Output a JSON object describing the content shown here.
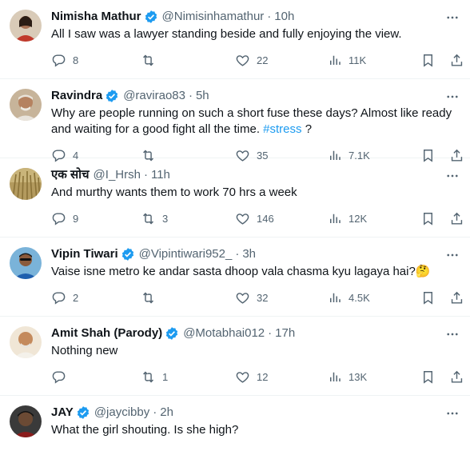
{
  "colors": {
    "accent": "#1d9bf0",
    "text": "#0f1419",
    "muted": "#536471",
    "divider": "#eff3f4"
  },
  "tweets": [
    {
      "name": "Nimisha Mathur",
      "verified": true,
      "handle": "@Nimisinhamathur",
      "time": "10h",
      "text": "All I saw was a lawyer standing beside and fully enjoying the view.",
      "replies": "8",
      "retweets": "",
      "likes": "22",
      "views": "11K"
    },
    {
      "name": "Ravindra",
      "verified": true,
      "handle": "@ravirao83",
      "time": "5h",
      "text": "Why are people running on such a short fuse these days? Almost like ready and waiting for a good fight all the time.",
      "hashtag": "#stress",
      "text_suffix": " ?",
      "replies": "4",
      "retweets": "",
      "likes": "35",
      "views": "7.1K"
    },
    {
      "name": "एक सोच",
      "verified": false,
      "handle": "@I_Hrsh",
      "time": "11h",
      "text": "And murthy wants them to work 70 hrs a week",
      "replies": "9",
      "retweets": "3",
      "likes": "146",
      "views": "12K"
    },
    {
      "name": "Vipin Tiwari",
      "verified": true,
      "handle": "@Vipintiwari952_",
      "time": "3h",
      "text": "Vaise isne metro ke andar sasta dhoop vala chasma kyu lagaya hai?🤔",
      "replies": "2",
      "retweets": "",
      "likes": "32",
      "views": "4.5K"
    },
    {
      "name": "Amit Shah (Parody)",
      "verified": true,
      "handle": "@Motabhai012",
      "time": "17h",
      "text": "Nothing new",
      "replies": "",
      "retweets": "1",
      "likes": "12",
      "views": "13K"
    },
    {
      "name": "JAY",
      "verified": true,
      "handle": "@jaycibby",
      "time": "2h",
      "text": "What the girl shouting. Is she high?",
      "replies": "",
      "retweets": "",
      "likes": "",
      "views": ""
    }
  ]
}
